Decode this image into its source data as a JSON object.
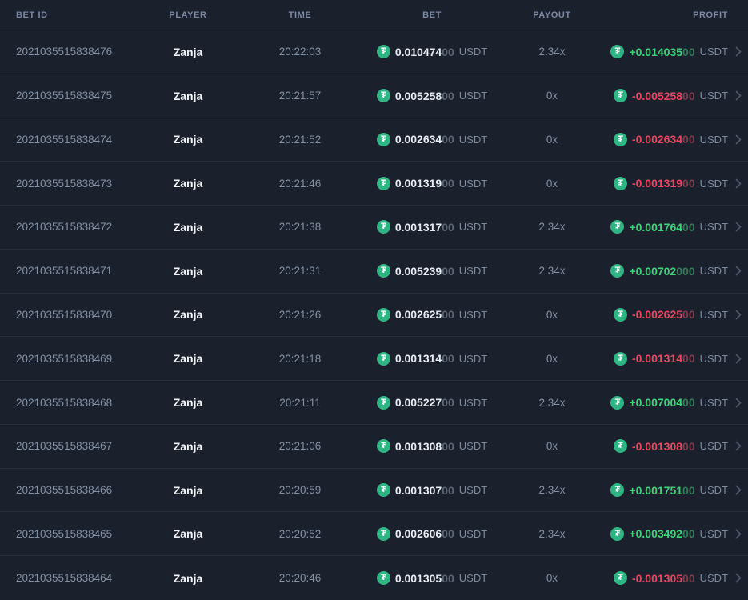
{
  "table": {
    "currency": "USDT",
    "headers": {
      "bet_id": "BET ID",
      "player": "PLAYER",
      "time": "TIME",
      "bet": "BET",
      "payout": "PAYOUT",
      "profit": "PROFIT"
    },
    "colors": {
      "background": "#1a212d",
      "row_divider": "#272f3d",
      "muted_text": "#8290a3",
      "bright_text": "#e7ecf3",
      "positive": "#3ed47c",
      "negative": "#ea4660",
      "tether_green": "#2fb583"
    },
    "icons": {
      "currency": "tether-icon",
      "currency_glyph": "₮",
      "row_action": "chevron-right-icon"
    },
    "rows": [
      {
        "bet_id": "2021035515838476",
        "player": "Zanja",
        "time": "20:22:03",
        "bet_main": "0.010474",
        "bet_dim": "00",
        "payout": "2.34x",
        "profit_main": "+0.014035",
        "profit_dim": "00",
        "positive": true
      },
      {
        "bet_id": "2021035515838475",
        "player": "Zanja",
        "time": "20:21:57",
        "bet_main": "0.005258",
        "bet_dim": "00",
        "payout": "0x",
        "profit_main": "-0.005258",
        "profit_dim": "00",
        "positive": false
      },
      {
        "bet_id": "2021035515838474",
        "player": "Zanja",
        "time": "20:21:52",
        "bet_main": "0.002634",
        "bet_dim": "00",
        "payout": "0x",
        "profit_main": "-0.002634",
        "profit_dim": "00",
        "positive": false
      },
      {
        "bet_id": "2021035515838473",
        "player": "Zanja",
        "time": "20:21:46",
        "bet_main": "0.001319",
        "bet_dim": "00",
        "payout": "0x",
        "profit_main": "-0.001319",
        "profit_dim": "00",
        "positive": false
      },
      {
        "bet_id": "2021035515838472",
        "player": "Zanja",
        "time": "20:21:38",
        "bet_main": "0.001317",
        "bet_dim": "00",
        "payout": "2.34x",
        "profit_main": "+0.001764",
        "profit_dim": "00",
        "positive": true
      },
      {
        "bet_id": "2021035515838471",
        "player": "Zanja",
        "time": "20:21:31",
        "bet_main": "0.005239",
        "bet_dim": "00",
        "payout": "2.34x",
        "profit_main": "+0.00702",
        "profit_dim": "000",
        "positive": true
      },
      {
        "bet_id": "2021035515838470",
        "player": "Zanja",
        "time": "20:21:26",
        "bet_main": "0.002625",
        "bet_dim": "00",
        "payout": "0x",
        "profit_main": "-0.002625",
        "profit_dim": "00",
        "positive": false
      },
      {
        "bet_id": "2021035515838469",
        "player": "Zanja",
        "time": "20:21:18",
        "bet_main": "0.001314",
        "bet_dim": "00",
        "payout": "0x",
        "profit_main": "-0.001314",
        "profit_dim": "00",
        "positive": false
      },
      {
        "bet_id": "2021035515838468",
        "player": "Zanja",
        "time": "20:21:11",
        "bet_main": "0.005227",
        "bet_dim": "00",
        "payout": "2.34x",
        "profit_main": "+0.007004",
        "profit_dim": "00",
        "positive": true
      },
      {
        "bet_id": "2021035515838467",
        "player": "Zanja",
        "time": "20:21:06",
        "bet_main": "0.001308",
        "bet_dim": "00",
        "payout": "0x",
        "profit_main": "-0.001308",
        "profit_dim": "00",
        "positive": false
      },
      {
        "bet_id": "2021035515838466",
        "player": "Zanja",
        "time": "20:20:59",
        "bet_main": "0.001307",
        "bet_dim": "00",
        "payout": "2.34x",
        "profit_main": "+0.001751",
        "profit_dim": "00",
        "positive": true
      },
      {
        "bet_id": "2021035515838465",
        "player": "Zanja",
        "time": "20:20:52",
        "bet_main": "0.002606",
        "bet_dim": "00",
        "payout": "2.34x",
        "profit_main": "+0.003492",
        "profit_dim": "00",
        "positive": true
      },
      {
        "bet_id": "2021035515838464",
        "player": "Zanja",
        "time": "20:20:46",
        "bet_main": "0.001305",
        "bet_dim": "00",
        "payout": "0x",
        "profit_main": "-0.001305",
        "profit_dim": "00",
        "positive": false
      }
    ]
  }
}
